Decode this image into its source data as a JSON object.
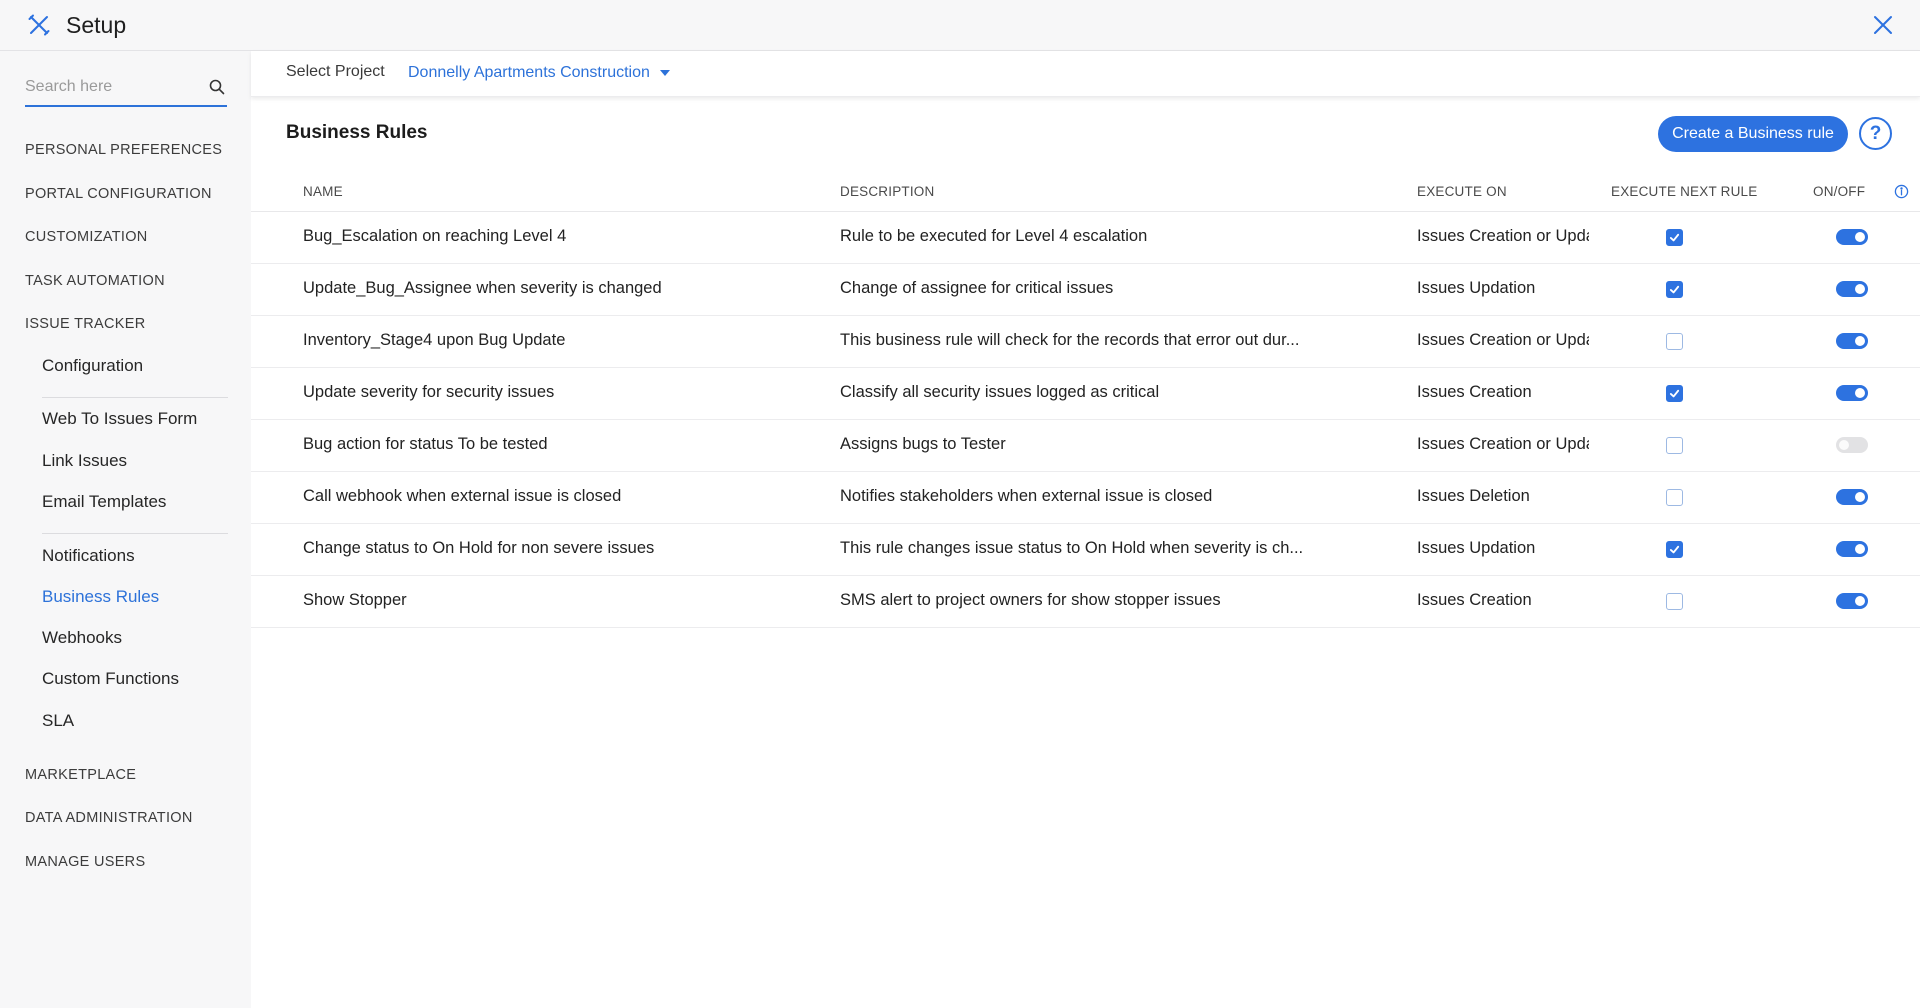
{
  "app": {
    "title": "Setup"
  },
  "search": {
    "placeholder": "Search here",
    "value": ""
  },
  "sidebar": {
    "sections": {
      "personal_preferences": "PERSONAL PREFERENCES",
      "portal_configuration": "PORTAL CONFIGURATION",
      "customization": "CUSTOMIZATION",
      "task_automation": "TASK AUTOMATION",
      "issue_tracker": "ISSUE TRACKER",
      "marketplace": "MARKETPLACE",
      "data_administration": "DATA ADMINISTRATION",
      "manage_users": "MANAGE USERS"
    },
    "issue_tracker_items": {
      "configuration": "Configuration",
      "web_to_issues_form": "Web To Issues Form",
      "link_issues": "Link Issues",
      "email_templates": "Email Templates",
      "notifications": "Notifications",
      "business_rules": "Business Rules",
      "webhooks": "Webhooks",
      "custom_functions": "Custom Functions",
      "sla": "SLA"
    },
    "active_item": "Business Rules"
  },
  "project": {
    "label": "Select Project",
    "selected": "Donnelly Apartments Construction"
  },
  "main": {
    "title": "Business Rules",
    "create_button": "Create a Business rule",
    "help_label": "?"
  },
  "table": {
    "columns": {
      "name": "NAME",
      "description": "DESCRIPTION",
      "execute_on": "EXECUTE ON",
      "execute_next_rule": "EXECUTE NEXT RULE",
      "on_off": "ON/OFF"
    },
    "rows": [
      {
        "name": "Bug_Escalation on reaching Level 4",
        "description": "Rule to be executed for Level 4 escalation",
        "execute_on": "Issues Creation or Upda",
        "execute_next_rule": true,
        "enabled": true
      },
      {
        "name": "Update_Bug_Assignee when severity is changed",
        "description": "Change of assignee for critical issues",
        "execute_on": "Issues Updation",
        "execute_next_rule": true,
        "enabled": true
      },
      {
        "name": "Inventory_Stage4 upon Bug Update",
        "description": "This business rule will check for the records that error out dur...",
        "execute_on": "Issues Creation or Upda",
        "execute_next_rule": false,
        "enabled": true
      },
      {
        "name": "Update severity for security issues",
        "description": "Classify all security issues logged as critical",
        "execute_on": "Issues Creation",
        "execute_next_rule": true,
        "enabled": true
      },
      {
        "name": "Bug action for status To be tested",
        "description": "Assigns bugs to Tester",
        "execute_on": "Issues Creation or Upda",
        "execute_next_rule": false,
        "enabled": false
      },
      {
        "name": "Call webhook when external issue is closed",
        "description": "Notifies stakeholders when external issue is closed",
        "execute_on": "Issues Deletion",
        "execute_next_rule": false,
        "enabled": true
      },
      {
        "name": "Change status to On Hold for non severe issues",
        "description": "This rule changes issue status to On Hold when severity is ch...",
        "execute_on": "Issues Updation",
        "execute_next_rule": true,
        "enabled": true
      },
      {
        "name": "Show Stopper",
        "description": "SMS alert to project owners for show stopper issues",
        "execute_on": "Issues Creation",
        "execute_next_rule": false,
        "enabled": true
      }
    ]
  },
  "icons": {
    "app": "tools-icon",
    "close": "close-icon",
    "search": "search-icon",
    "dropdown": "caret-down-icon",
    "help": "help-icon",
    "info": "info-icon",
    "checkbox": "checkbox-icon",
    "toggle": "toggle-switch"
  },
  "colors": {
    "accent": "#2d72e0",
    "sidebar_bg": "#f7f7f8",
    "toggle_off": "#e2e2e4"
  }
}
